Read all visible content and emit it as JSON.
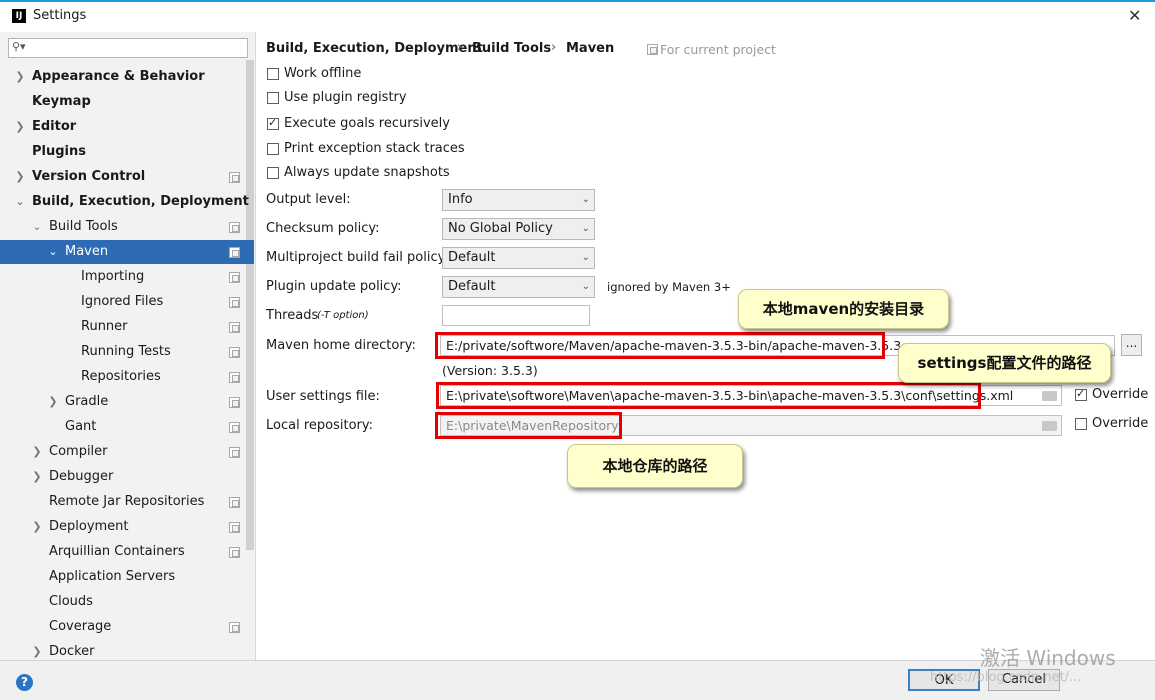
{
  "window": {
    "title": "Settings",
    "close": "✕",
    "logo": "IJ"
  },
  "search": {
    "placeholder": ""
  },
  "sidebar": {
    "items": [
      {
        "label": "Appearance & Behavior"
      },
      {
        "label": "Keymap"
      },
      {
        "label": "Editor"
      },
      {
        "label": "Plugins"
      },
      {
        "label": "Version Control"
      },
      {
        "label": "Build, Execution, Deployment"
      },
      {
        "label": "Build Tools"
      },
      {
        "label": "Maven"
      },
      {
        "label": "Importing"
      },
      {
        "label": "Ignored Files"
      },
      {
        "label": "Runner"
      },
      {
        "label": "Running Tests"
      },
      {
        "label": "Repositories"
      },
      {
        "label": "Gradle"
      },
      {
        "label": "Gant"
      },
      {
        "label": "Compiler"
      },
      {
        "label": "Debugger"
      },
      {
        "label": "Remote Jar Repositories"
      },
      {
        "label": "Deployment"
      },
      {
        "label": "Arquillian Containers"
      },
      {
        "label": "Application Servers"
      },
      {
        "label": "Clouds"
      },
      {
        "label": "Coverage"
      },
      {
        "label": "Docker"
      }
    ]
  },
  "breadcrumb": {
    "items": [
      "Build, Execution, Deployment",
      "Build Tools",
      "Maven"
    ],
    "separator": "›",
    "scope": "For current project"
  },
  "checkboxes": [
    {
      "label": "Work offline",
      "checked": false
    },
    {
      "label": "Use plugin registry",
      "checked": false
    },
    {
      "label": "Execute goals recursively",
      "checked": true
    },
    {
      "label": "Print exception stack traces",
      "checked": false
    },
    {
      "label": "Always update snapshots",
      "checked": false
    }
  ],
  "form": {
    "output_level": {
      "label": "Output level:",
      "value": "Info"
    },
    "checksum_policy": {
      "label": "Checksum policy:",
      "value": "No Global Policy"
    },
    "multiproject_fail": {
      "label": "Multiproject build fail policy:",
      "value": "Default"
    },
    "plugin_update": {
      "label": "Plugin update policy:",
      "value": "Default",
      "note": "ignored by Maven 3+"
    },
    "threads": {
      "label": "Threads",
      "hint": "(-T option)",
      "value": ""
    },
    "maven_home": {
      "label": "Maven home directory:",
      "value": "E:/private/softwore/Maven/apache-maven-3.5.3-bin/apache-maven-3.5.3",
      "version": "(Version: 3.5.3)",
      "browse": "..."
    },
    "user_settings": {
      "label": "User settings file:",
      "value": "E:\\private\\softwore\\Maven\\apache-maven-3.5.3-bin\\apache-maven-3.5.3\\conf\\settings.xml",
      "override_label": "Override",
      "override_checked": true
    },
    "local_repo": {
      "label": "Local repository:",
      "value": "E:\\private\\MavenRepository",
      "override_label": "Override",
      "override_checked": false
    }
  },
  "callouts": {
    "maven_home": "本地maven的安装目录",
    "settings": "settings配置文件的路径",
    "repo": "本地仓库的路径"
  },
  "footer": {
    "help": "?",
    "ok": "OK",
    "cancel": "Cancel",
    "watermark": "激活 Windows",
    "csdn": "https://blog.csdn.net/..."
  },
  "colors": {
    "selection": "#2d6cb5",
    "annotation_red": "#e40000",
    "callout_bg": "#ffffcc"
  }
}
